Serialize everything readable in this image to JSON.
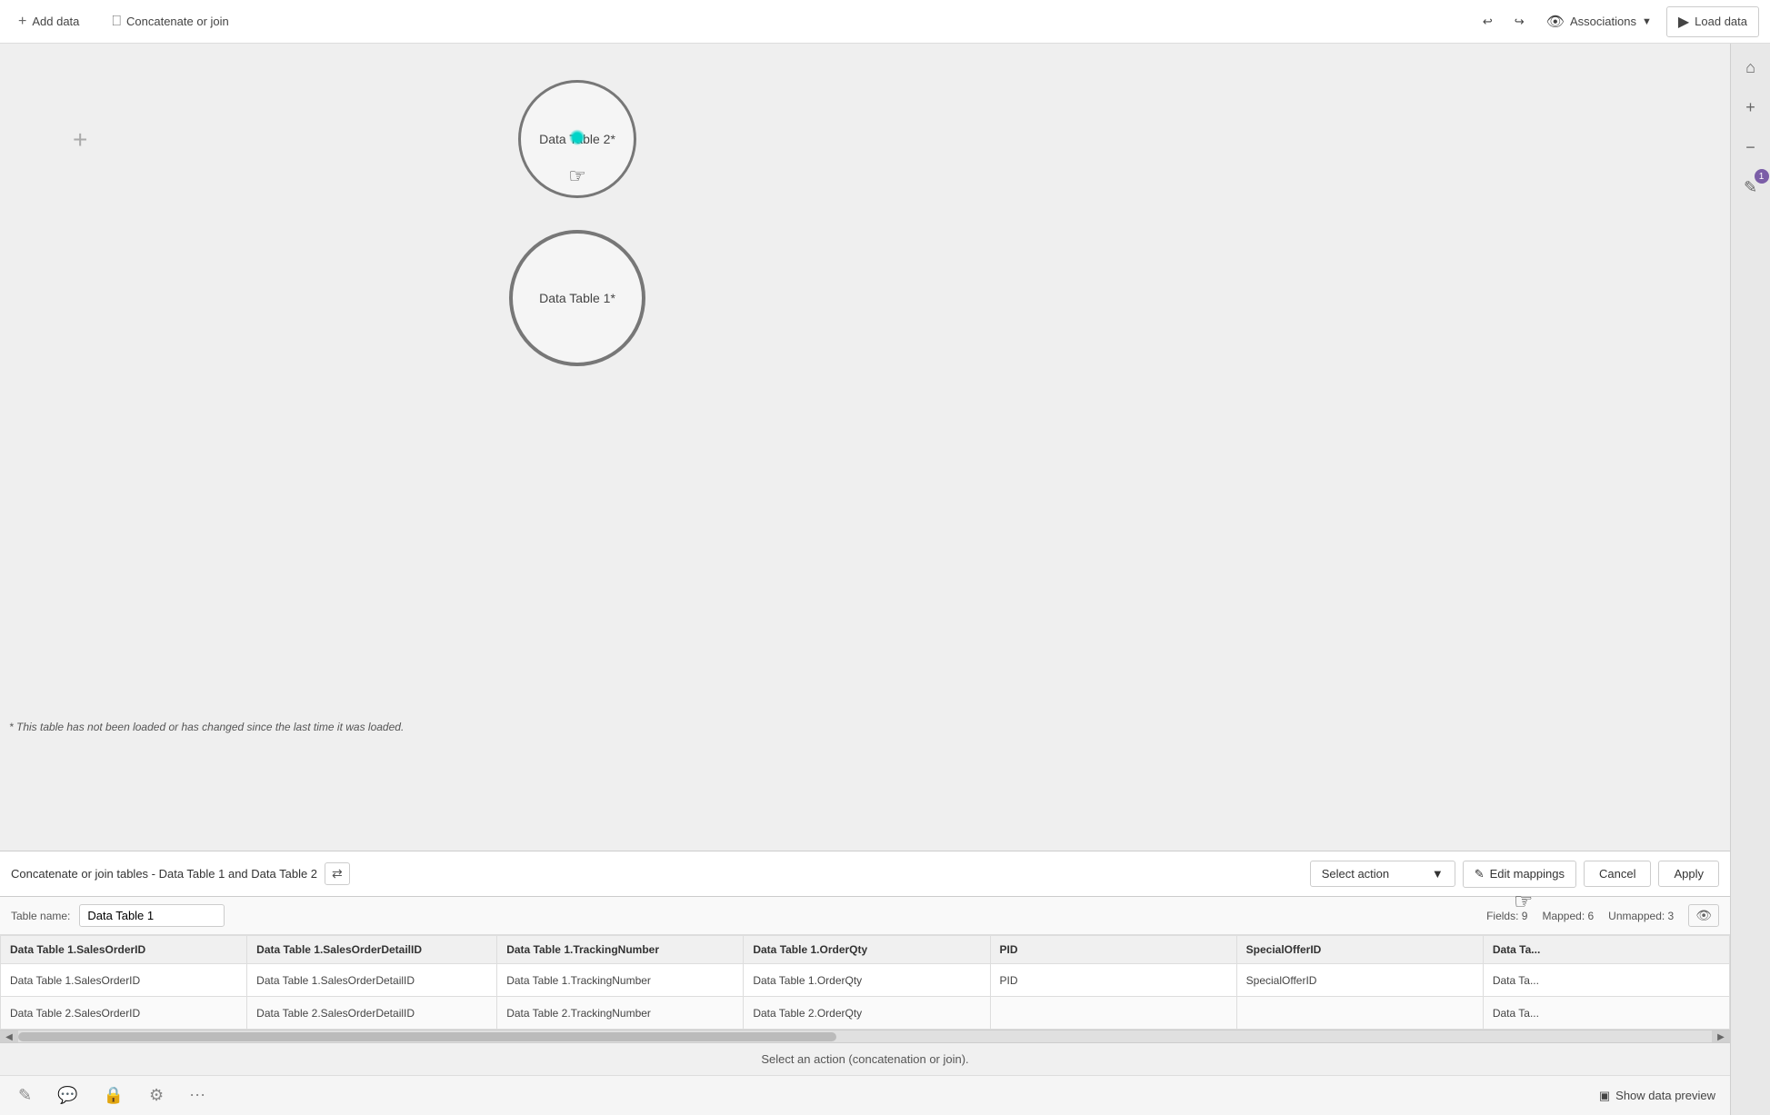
{
  "toolbar": {
    "add_data_label": "Add data",
    "concatenate_join_label": "Concatenate or join",
    "associations_label": "Associations",
    "load_data_label": "Load data",
    "undo_title": "Undo",
    "redo_title": "Redo"
  },
  "canvas": {
    "warning_message": "* This table has not been loaded or has changed since the last time it was loaded.",
    "table2_label": "Data Table 2*",
    "table1_label": "Data Table 1*",
    "plus_title": "Add"
  },
  "join_toolbar": {
    "title": "Concatenate or join tables - Data Table 1 and Data Table 2",
    "select_action_label": "Select action",
    "edit_mappings_label": "Edit mappings",
    "cancel_label": "Cancel",
    "apply_label": "Apply"
  },
  "table_name_section": {
    "label": "Table name:",
    "value": "Data Table 1",
    "fields_label": "Fields: 9",
    "mapped_label": "Mapped: 6",
    "unmapped_label": "Unmapped: 3"
  },
  "grid": {
    "columns": [
      "Data Table 1.SalesOrderID",
      "Data Table 1.SalesOrderDetailID",
      "Data Table 1.TrackingNumber",
      "Data Table 1.OrderQty",
      "PID",
      "SpecialOfferID",
      "Data Ta..."
    ],
    "rows": [
      {
        "cells": [
          "Data Table 1.SalesOrderID",
          "Data Table 1.SalesOrderDetailID",
          "Data Table 1.TrackingNumber",
          "Data Table 1.OrderQty",
          "PID",
          "SpecialOfferID",
          "Data Ta..."
        ],
        "empty_from": -1
      },
      {
        "cells": [
          "Data Table 2.SalesOrderID",
          "Data Table 2.SalesOrderDetailID",
          "Data Table 2.TrackingNumber",
          "Data Table 2.OrderQty",
          "",
          "",
          "Data Ta..."
        ],
        "empty_from": 4
      }
    ]
  },
  "status_bar": {
    "message": "Select an action (concatenation or join)."
  },
  "bottom_bar": {
    "show_preview_label": "Show data preview"
  },
  "sidebar": {
    "notification_count": "1"
  }
}
